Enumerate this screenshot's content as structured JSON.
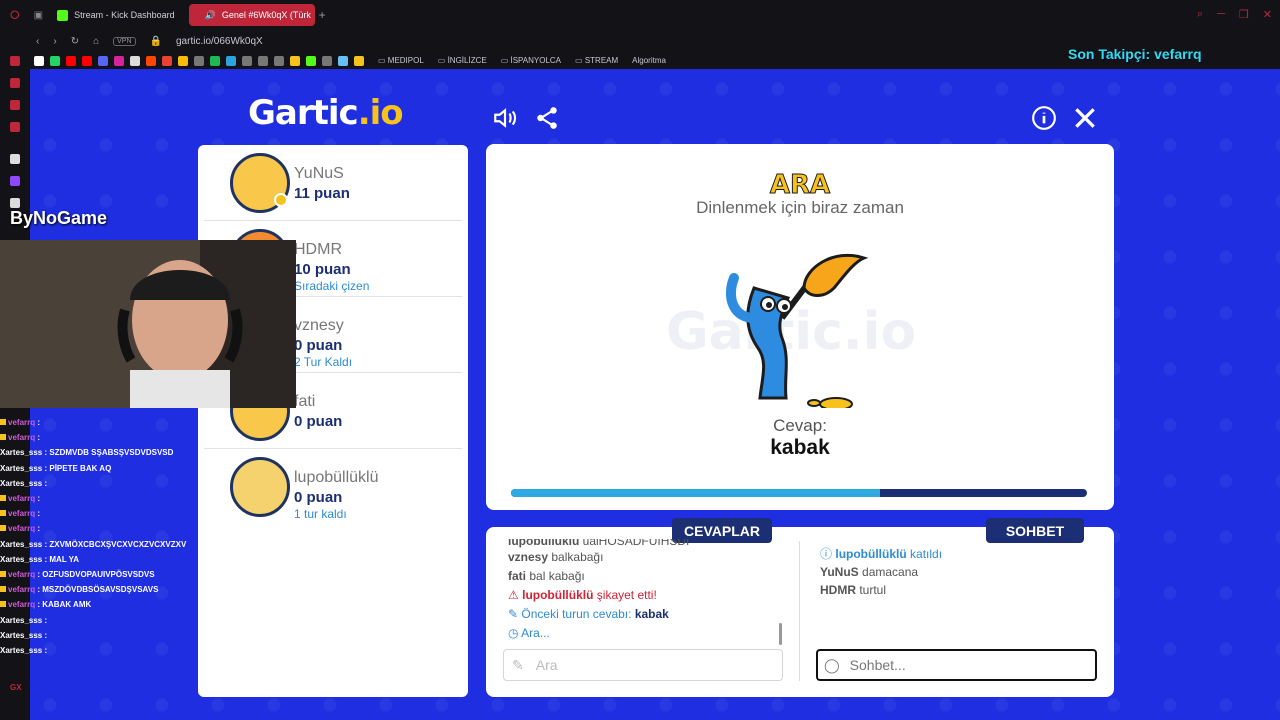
{
  "browser": {
    "tabs": [
      {
        "label": "Stream - Kick Dashboard"
      },
      {
        "label": "Genel #6Wk0qX (Türk"
      }
    ],
    "url": "gartic.io/066Wk0qX",
    "vpn": "VPN",
    "bookmarks": [
      "MEDIPOL",
      "İNGİLİZCE",
      "İSPANYOLCA",
      "STREAM",
      "Algoritma"
    ]
  },
  "overlay": {
    "follower": "Son Takipçi: vefarrq",
    "sponsor": "ByNoGame",
    "gx": "GX",
    "chat": [
      {
        "user": "vefarrq",
        "text": ":",
        "color": "purple"
      },
      {
        "user": "vefarrq",
        "text": ":",
        "color": "purple"
      },
      {
        "user": "Xartes_sss",
        "text": ": SZDMVDB SŞABSŞVSDVDSVSD",
        "color": "white"
      },
      {
        "user": "Xartes_sss",
        "text": ": PİPETE BAK AQ",
        "color": "white"
      },
      {
        "user": "Xartes_sss",
        "text": ":",
        "color": "white"
      },
      {
        "user": "vefarrq",
        "text": ":",
        "color": "purple"
      },
      {
        "user": "vefarrq",
        "text": ":",
        "color": "purple"
      },
      {
        "user": "vefarrq",
        "text": ":",
        "color": "purple"
      },
      {
        "user": "Xartes_sss",
        "text": ": ZXVMÖXCBCXŞVCXVCXZVCXVZXV",
        "color": "white"
      },
      {
        "user": "Xartes_sss",
        "text": ": MAL YA",
        "color": "white"
      },
      {
        "user": "vefarrq",
        "text": ": OZFUSDVOPAUIVPÖSVSDVS",
        "color": "purple"
      },
      {
        "user": "vefarrq",
        "text": ": MSZDÖVDBSÖSAVSDŞVSAVS",
        "color": "purple"
      },
      {
        "user": "vefarrq",
        "text": ": KABAK AMK",
        "color": "purple"
      },
      {
        "user": "Xartes_sss",
        "text": ":",
        "color": "white"
      },
      {
        "user": "Xartes_sss",
        "text": ":",
        "color": "white"
      },
      {
        "user": "Xartes_sss",
        "text": ":",
        "color": "white"
      }
    ]
  },
  "game": {
    "logo": "Gartic",
    "logo_io": ".io",
    "players": [
      {
        "name": "YuNuS",
        "points": "11 puan",
        "status": ""
      },
      {
        "name": "HDMR",
        "points": "10 puan",
        "status": "Sıradaki çizen"
      },
      {
        "name": "vznesy",
        "points": "0 puan",
        "status": "2 Tur Kaldı"
      },
      {
        "name": "fati",
        "points": "0 puan",
        "status": ""
      },
      {
        "name": "lupobüllüklü",
        "points": "0 puan",
        "status": "1 tur kaldı"
      }
    ],
    "canvas": {
      "title": "ARA",
      "subtitle": "Dinlenmek için biraz zaman",
      "watermark": "Gartic.io",
      "answer_label": "Cevap:",
      "answer_value": "kabak",
      "progress": 0.64
    },
    "answers_tab": "CEVAPLAR",
    "chat_tab": "SOHBET",
    "answers": {
      "partial": {
        "user": "lupobüllüklü",
        "text": "uaiHOSADFUIHSDI"
      },
      "lines": [
        {
          "user": "vznesy",
          "text": "balkabağı"
        },
        {
          "user": "fati",
          "text": "bal kabağı"
        }
      ],
      "report": {
        "user": "lupobüllüklü",
        "text": "şikayet etti!"
      },
      "prev_answer_label": "Önceki turun cevabı:",
      "prev_answer_value": "kabak",
      "waiting": "Ara...",
      "input_placeholder": "Ara"
    },
    "chat": {
      "join": {
        "user": "lupobüllüklü",
        "text": "katıldı"
      },
      "lines": [
        {
          "user": "YuNuS",
          "text": "damacana"
        },
        {
          "user": "HDMR",
          "text": "turtul"
        }
      ],
      "input_placeholder": "Sohbet..."
    }
  }
}
